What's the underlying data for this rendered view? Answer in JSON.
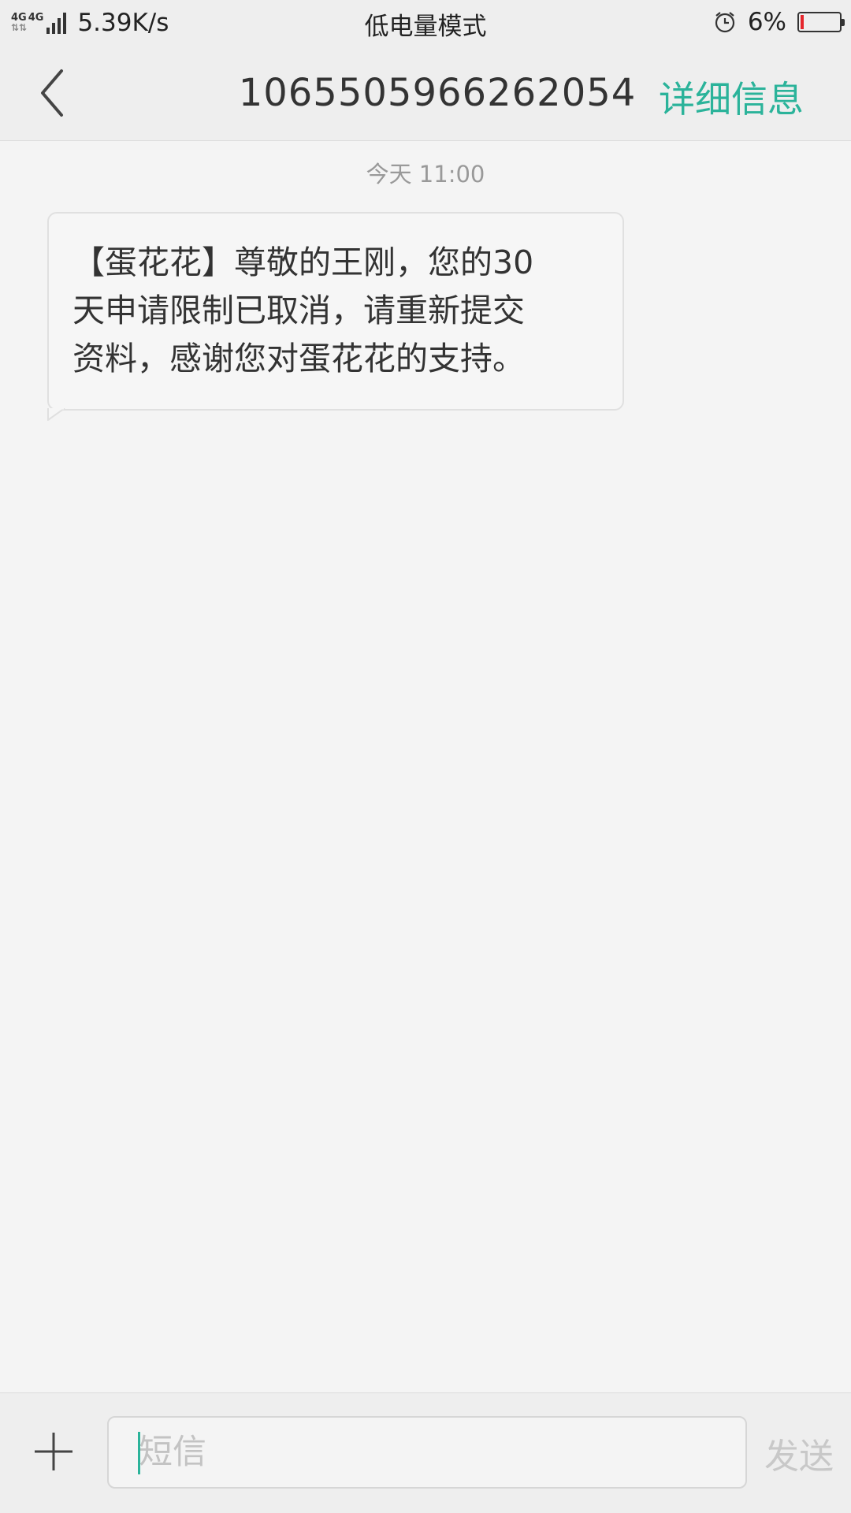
{
  "status_bar": {
    "net_type_1": "4G",
    "net_type_2": "4G",
    "net_speed": "5.39K/s",
    "mode": "低电量模式",
    "battery_percent": "6%",
    "battery_level": 0.06,
    "icons": [
      "signal-icon",
      "alarm-icon",
      "battery-icon"
    ]
  },
  "header": {
    "back_icon": "chevron-left-icon",
    "title": "1065505966262054",
    "detail_label": "详细信息",
    "accent_color": "#2bb39a"
  },
  "conversation": {
    "timestamp": "今天 11:00",
    "messages": [
      {
        "direction": "incoming",
        "lines": [
          "【蛋花花】尊敬的王刚，您的30",
          "天申请限制已取消，请重新提交",
          "资料，感谢您对蛋花花的支持。"
        ]
      }
    ]
  },
  "input_bar": {
    "add_icon": "plus-icon",
    "placeholder": "短信",
    "value": "",
    "send_label": "发送"
  }
}
